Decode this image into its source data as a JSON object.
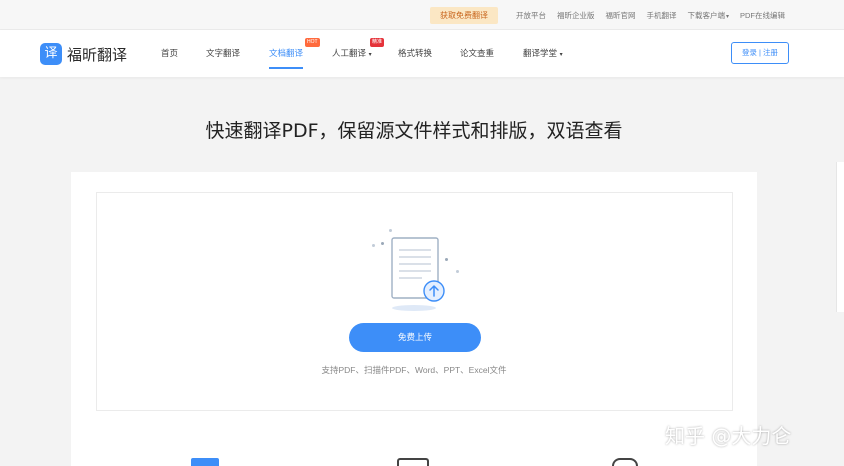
{
  "topbar": {
    "promo": "获取免费翻译",
    "links": [
      "开放平台",
      "福昕企业版",
      "福昕官网",
      "手机翻译",
      "下载客户端",
      "PDF在线编辑"
    ]
  },
  "navbar": {
    "logo_icon": "译",
    "logo_text": "福昕翻译",
    "items": [
      {
        "label": "首页"
      },
      {
        "label": "文字翻译"
      },
      {
        "label": "文档翻译",
        "badge": "HOT"
      },
      {
        "label": "人工翻译",
        "badge": "精准"
      },
      {
        "label": "格式转换"
      },
      {
        "label": "论文查重"
      },
      {
        "label": "翻译学堂"
      }
    ],
    "login": "登录 | 注册"
  },
  "main": {
    "headline": "快速翻译PDF，保留源文件样式和排版，双语查看",
    "upload_button": "免费上传",
    "supported_formats": "支持PDF、扫描件PDF、Word、PPT、Excel文件"
  },
  "watermark": "知乎 @大力仑",
  "colors": {
    "accent": "#3d8ef8",
    "promo_bg": "#fbe7c4",
    "hot_badge": "#ff6a3d",
    "precise_badge": "#e5333a"
  }
}
